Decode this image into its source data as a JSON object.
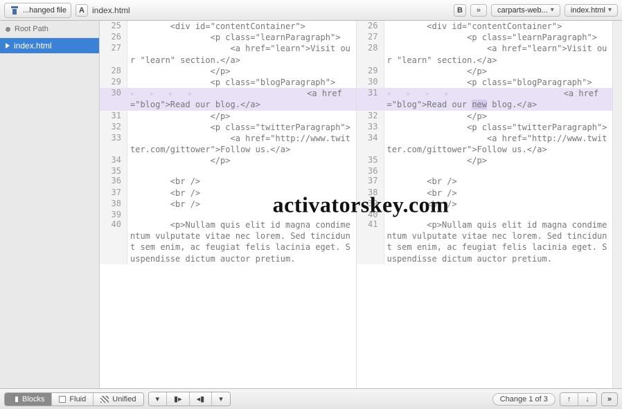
{
  "toolbar": {
    "changed_file_label": "...hanged file",
    "badge_a": "A",
    "file_a": "index.html",
    "badge_b": "B",
    "crumb_more": "»",
    "crumb_repo": "carparts-web...",
    "crumb_file": "index.html"
  },
  "sidebar": {
    "root_label": "Root Path",
    "items": [
      {
        "label": "index.html",
        "active": true
      }
    ]
  },
  "diff": {
    "left": [
      {
        "n": "25",
        "t": "        <div id=\"contentContainer\">"
      },
      {
        "n": "26",
        "t": "                <p class=\"learnParagraph\">"
      },
      {
        "n": "27",
        "t": "                    <a href=\"learn\">Visit our \"learn\" section.</a>"
      },
      {
        "n": "28",
        "t": "                </p>"
      },
      {
        "n": "29",
        "t": "                <p class=\"blogParagraph\">"
      },
      {
        "n": "30",
        "hl": true,
        "arrows": true,
        "t": "                    <a href=\"blog\">Read our blog.</a>"
      },
      {
        "n": "31",
        "t": "                </p>"
      },
      {
        "n": "32",
        "t": "                <p class=\"twitterParagraph\">"
      },
      {
        "n": "33",
        "t": "                    <a href=\"http://www.twitter.com/gittower\">Follow us.</a>"
      },
      {
        "n": "34",
        "t": "                </p>"
      },
      {
        "n": "35",
        "t": ""
      },
      {
        "n": "36",
        "t": "        <br />"
      },
      {
        "n": "37",
        "t": "        <br />"
      },
      {
        "n": "38",
        "t": "        <br />"
      },
      {
        "n": "39",
        "t": ""
      },
      {
        "n": "40",
        "t": "        <p>Nullam quis elit id magna condimentum vulputate vitae nec lorem. Sed tincidunt sem enim, ac feugiat felis lacinia eget. Suspendisse dictum auctor pretium."
      }
    ],
    "right": [
      {
        "n": "26",
        "t": "        <div id=\"contentContainer\">"
      },
      {
        "n": "27",
        "t": "                <p class=\"learnParagraph\">"
      },
      {
        "n": "28",
        "t": "                    <a href=\"learn\">Visit our \"learn\" section.</a>"
      },
      {
        "n": "29",
        "t": "                </p>"
      },
      {
        "n": "30",
        "t": "                <p class=\"blogParagraph\">"
      },
      {
        "n": "31",
        "hl": true,
        "arrows": true,
        "t": "                    <a href=\"blog\">Read our ",
        "chg": "new",
        "t2": " blog.</a>"
      },
      {
        "n": "32",
        "t": "                </p>"
      },
      {
        "n": "33",
        "t": "                <p class=\"twitterParagraph\">"
      },
      {
        "n": "34",
        "t": "                    <a href=\"http://www.twitter.com/gittower\">Follow us.</a>"
      },
      {
        "n": "35",
        "t": "                </p>"
      },
      {
        "n": "36",
        "t": ""
      },
      {
        "n": "37",
        "t": "        <br />"
      },
      {
        "n": "38",
        "t": "        <br />"
      },
      {
        "n": "39",
        "t": "        <br />"
      },
      {
        "n": "40",
        "t": ""
      },
      {
        "n": "41",
        "t": "        <p>Nullam quis elit id magna condimentum vulputate vitae nec lorem. Sed tincidunt sem enim, ac feugiat felis lacinia eget. Suspendisse dictum auctor pretium."
      }
    ]
  },
  "bottom": {
    "view_blocks": "Blocks",
    "view_fluid": "Fluid",
    "view_unified": "Unified",
    "change_status": "Change 1 of 3"
  },
  "watermark": "activatorskey.com"
}
